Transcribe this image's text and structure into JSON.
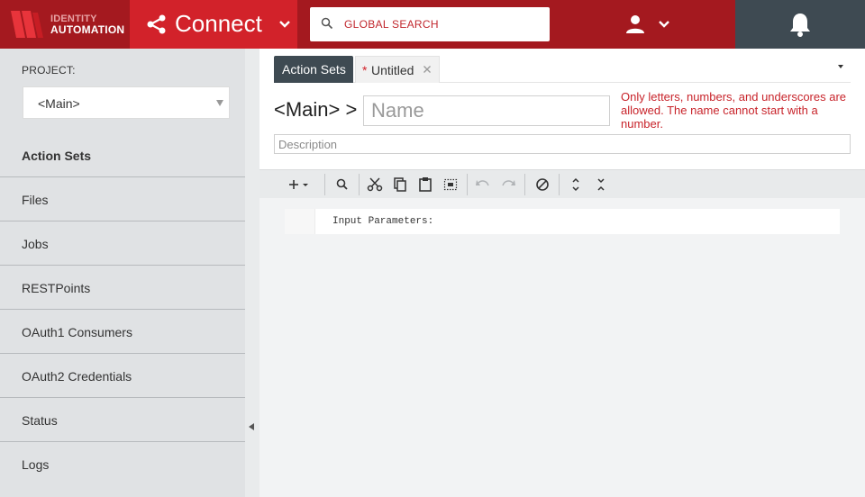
{
  "header": {
    "logo_line1": "IDENTITY",
    "logo_line2": "AUTOMATION",
    "app_name": "Connect",
    "search_placeholder": "GLOBAL SEARCH",
    "icons": [
      "share-icon",
      "chevron-down-icon",
      "search-icon",
      "user-icon",
      "bell-icon"
    ],
    "colors": {
      "header_bg": "#a4191f",
      "app_bg": "#d2222a",
      "bell_bg": "#3e4a52"
    }
  },
  "sidebar": {
    "project_label": "PROJECT:",
    "project_value": "<Main>",
    "items": [
      {
        "label": "Action Sets",
        "active": true
      },
      {
        "label": "Files"
      },
      {
        "label": "Jobs"
      },
      {
        "label": "RESTPoints"
      },
      {
        "label": "OAuth1 Consumers"
      },
      {
        "label": "OAuth2 Credentials"
      },
      {
        "label": "Status"
      },
      {
        "label": "Logs"
      }
    ]
  },
  "tabs": [
    {
      "label": "Action Sets",
      "active": true
    },
    {
      "label": "Untitled",
      "modified_marker": "*",
      "closable": true
    }
  ],
  "form": {
    "breadcrumb": "<Main> >",
    "name_placeholder": "Name",
    "name_value": "",
    "name_error": "Only letters, numbers, and underscores are allowed. The name cannot start with a number.",
    "description_placeholder": "Description",
    "description_value": ""
  },
  "toolbar": {
    "buttons": [
      "add",
      "search",
      "cut",
      "copy",
      "paste",
      "select-all",
      "undo",
      "redo",
      "disable",
      "expand",
      "collapse"
    ]
  },
  "editor": {
    "lines": [
      "Input Parameters:"
    ]
  }
}
